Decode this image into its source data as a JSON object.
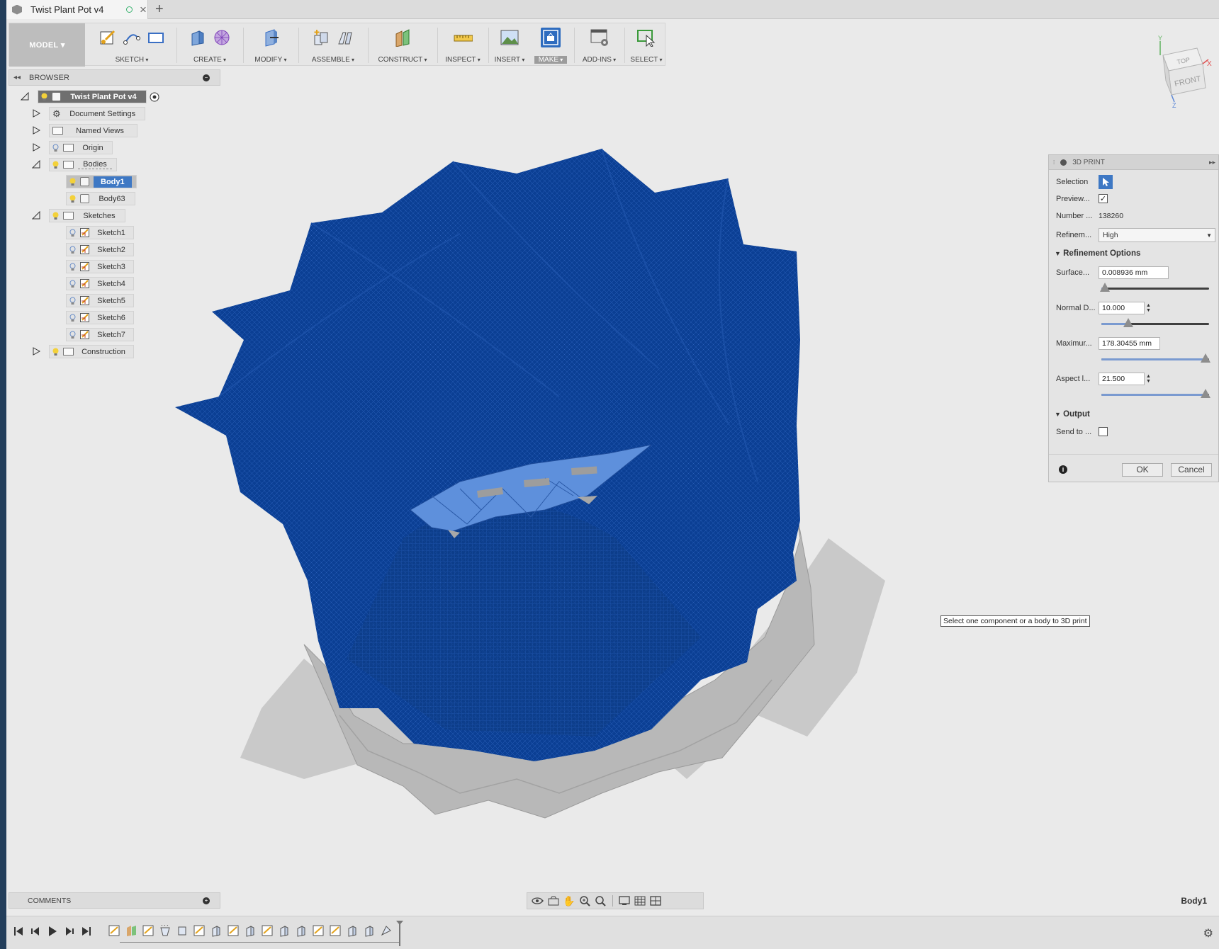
{
  "document": {
    "title": "Twist Plant Pot v4",
    "new_tab": "+"
  },
  "workspace": {
    "label": "MODEL"
  },
  "toolbar": {
    "groups": [
      {
        "label": "SKETCH",
        "icons": [
          "create-sketch-icon",
          "arc-icon",
          "rectangle-icon"
        ]
      },
      {
        "label": "CREATE",
        "icons": [
          "extrude-icon",
          "form-icon"
        ]
      },
      {
        "label": "MODIFY",
        "icons": [
          "press-pull-icon"
        ]
      },
      {
        "label": "ASSEMBLE",
        "icons": [
          "new-component-icon",
          "joint-icon"
        ]
      },
      {
        "label": "CONSTRUCT",
        "icons": [
          "offset-plane-icon"
        ]
      },
      {
        "label": "INSPECT",
        "icons": [
          "measure-icon"
        ]
      },
      {
        "label": "INSERT",
        "icons": [
          "insert-image-icon"
        ]
      },
      {
        "label": "MAKE",
        "icons": [
          "3d-print-icon"
        ]
      },
      {
        "label": "ADD-INS",
        "icons": [
          "scripts-icon"
        ]
      },
      {
        "label": "SELECT",
        "icons": [
          "select-icon"
        ]
      }
    ]
  },
  "browser": {
    "title": "BROWSER",
    "root": "Twist Plant Pot v4",
    "items": [
      {
        "label": "Document Settings"
      },
      {
        "label": "Named Views"
      },
      {
        "label": "Origin"
      },
      {
        "label": "Bodies"
      },
      {
        "label": "Body1"
      },
      {
        "label": "Body63"
      },
      {
        "label": "Sketches"
      },
      {
        "label": "Sketch1"
      },
      {
        "label": "Sketch2"
      },
      {
        "label": "Sketch3"
      },
      {
        "label": "Sketch4"
      },
      {
        "label": "Sketch5"
      },
      {
        "label": "Sketch6"
      },
      {
        "label": "Sketch7"
      },
      {
        "label": "Construction"
      }
    ]
  },
  "viewcube": {
    "top": "TOP",
    "front": "FRONT",
    "x": "X",
    "y": "Y",
    "z": "Z"
  },
  "print_panel": {
    "title": "3D PRINT",
    "selection_label": "Selection",
    "preview_label": "Preview...",
    "preview_checked": true,
    "number_label": "Number ...",
    "number_value": "138260",
    "refinement_label": "Refinem...",
    "refinement_value": "High",
    "refinement_options_title": "Refinement Options",
    "surface_label": "Surface...",
    "surface_value": "0.008936 mm",
    "surface_level": 0.0,
    "normal_label": "Normal D...",
    "normal_value": "10.000",
    "normal_level": 0.23,
    "maximum_label": "Maximur...",
    "maximum_value": "178.30455 mm",
    "maximum_level": 1.0,
    "aspect_label": "Aspect l...",
    "aspect_value": "21.500",
    "aspect_level": 1.0,
    "output_title": "Output",
    "send_to_label": "Send to ...",
    "send_to_checked": false,
    "ok_label": "OK",
    "cancel_label": "Cancel"
  },
  "tooltip": "Select one component or a body to 3D print",
  "comments": {
    "title": "COMMENTS"
  },
  "status": {
    "selection": "Body1"
  },
  "colors": {
    "mesh_blue": "#0b3f94",
    "active_blue": "#3e78c4",
    "panel_bg": "#e4e4e4"
  }
}
